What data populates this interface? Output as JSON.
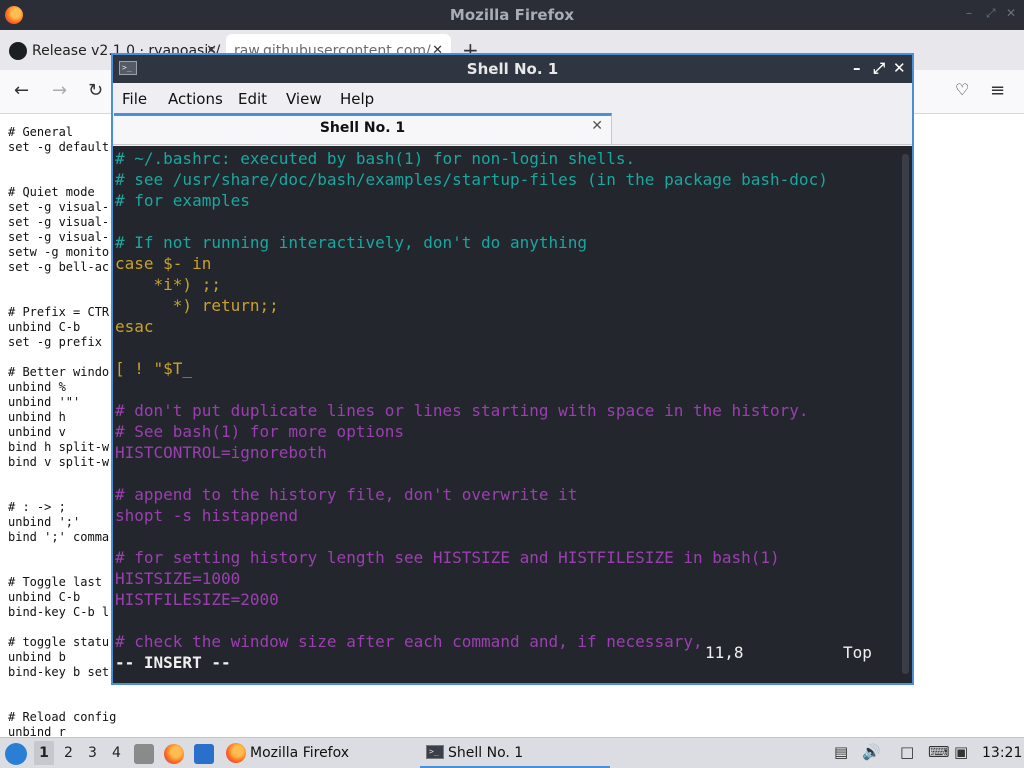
{
  "firefox": {
    "window_title": "Mozilla Firefox",
    "tabs": [
      {
        "label": "Release v2.1.0 · ryanoasis/",
        "active": false
      },
      {
        "label": "raw.githubusercontent.com/",
        "active": true
      }
    ],
    "new_tab_label": "+",
    "content_lines": [
      "# General",
      "set -g default",
      "",
      "",
      "# Quiet mode",
      "set -g visual-",
      "set -g visual-",
      "set -g visual-",
      "setw -g monito",
      "set -g bell-ac",
      "",
      "",
      "# Prefix = CTR",
      "unbind C-b",
      "set -g prefix",
      "",
      "# Better windo",
      "unbind %",
      "unbind '\"'",
      "unbind h",
      "unbind v",
      "bind h split-w",
      "bind v split-w",
      "",
      "",
      "# : -> ;",
      "unbind ';'",
      "bind ';' comma",
      "",
      "",
      "# Toggle last",
      "unbind C-b",
      "bind-key C-b l",
      "",
      "# toggle statu",
      "unbind b",
      "bind-key b set",
      "",
      "",
      "# Reload config",
      "unbind r"
    ]
  },
  "shell": {
    "window_title": "Shell No. 1",
    "menu": [
      "File",
      "Actions",
      "Edit",
      "View",
      "Help"
    ],
    "tab_label": "Shell No. 1",
    "lines": [
      {
        "text": "# ~/.bashrc: executed by bash(1) for non-login shells.",
        "color": "cyan"
      },
      {
        "text": "# see /usr/share/doc/bash/examples/startup-files (in the package bash-doc)",
        "color": "cyan"
      },
      {
        "text": "# for examples",
        "color": "cyan"
      },
      {
        "text": "",
        "color": "cyan"
      },
      {
        "text": "# If not running interactively, don't do anything",
        "color": "cyan"
      },
      {
        "text": "case $- in",
        "color": "yellow"
      },
      {
        "text": "    *i*) ;;",
        "color": "yellow"
      },
      {
        "text": "      *) return;;",
        "color": "yellow"
      },
      {
        "text": "esac",
        "color": "yellow"
      },
      {
        "text": "",
        "color": "yellow"
      },
      {
        "text": "[ ! \"$T_",
        "color": "yellow"
      },
      {
        "text": "",
        "color": "yellow"
      },
      {
        "text": "# don't put duplicate lines or lines starting with space in the history.",
        "color": "purple"
      },
      {
        "text": "# See bash(1) for more options",
        "color": "purple"
      },
      {
        "text": "HISTCONTROL=ignoreboth",
        "color": "purple"
      },
      {
        "text": "",
        "color": "purple"
      },
      {
        "text": "# append to the history file, don't overwrite it",
        "color": "purple"
      },
      {
        "text": "shopt -s histappend",
        "color": "purple"
      },
      {
        "text": "",
        "color": "purple"
      },
      {
        "text": "# for setting history length see HISTSIZE and HISTFILESIZE in bash(1)",
        "color": "purple"
      },
      {
        "text": "HISTSIZE=1000",
        "color": "purple"
      },
      {
        "text": "HISTFILESIZE=2000",
        "color": "purple"
      },
      {
        "text": "",
        "color": "purple"
      },
      {
        "text": "# check the window size after each command and, if necessary,",
        "color": "purple"
      },
      {
        "text": "-- INSERT --",
        "color": "white"
      }
    ],
    "status_position": "11,8",
    "status_scroll": "Top"
  },
  "taskbar": {
    "workspaces": [
      "1",
      "2",
      "3",
      "4"
    ],
    "tasks": [
      {
        "label": "Mozilla Firefox"
      },
      {
        "label": "Shell No. 1"
      }
    ],
    "clock": "13:21"
  },
  "colors": {
    "cyan": "#17a8a0",
    "yellow": "#c9a227",
    "purple": "#9b3fb0",
    "accent": "#4a90d9",
    "terminal_bg": "#24262e"
  }
}
